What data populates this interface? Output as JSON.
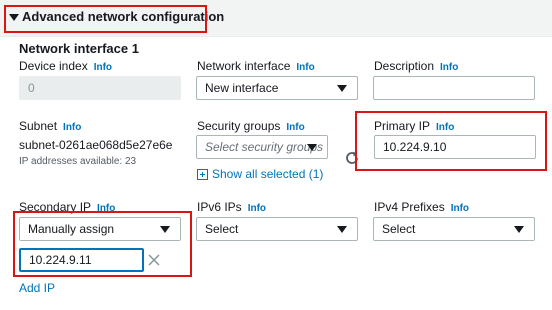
{
  "section": {
    "title": "Advanced network configuration"
  },
  "interface_heading": "Network interface 1",
  "info_label": "Info",
  "device_index": {
    "label": "Device index",
    "value": "0"
  },
  "network_interface": {
    "label": "Network interface",
    "selected": "New interface"
  },
  "description": {
    "label": "Description",
    "value": ""
  },
  "subnet": {
    "label": "Subnet",
    "value": "subnet-0261ae068d5e27e6e",
    "note": "IP addresses available: 23"
  },
  "security_groups": {
    "label": "Security groups",
    "placeholder": "Select security groups",
    "show_all": "Show all selected (1)"
  },
  "primary_ip": {
    "label": "Primary IP",
    "value": "10.224.9.10"
  },
  "secondary_ip": {
    "label": "Secondary IP",
    "selected": "Manually assign",
    "value": "10.224.9.11",
    "add_link": "Add IP"
  },
  "ipv6_ips": {
    "label": "IPv6 IPs",
    "selected": "Select"
  },
  "ipv4_prefixes": {
    "label": "IPv4 Prefixes",
    "selected": "Select"
  },
  "colors": {
    "info": "#0073bb",
    "highlight": "#d91515",
    "focus": "#0073bb"
  }
}
